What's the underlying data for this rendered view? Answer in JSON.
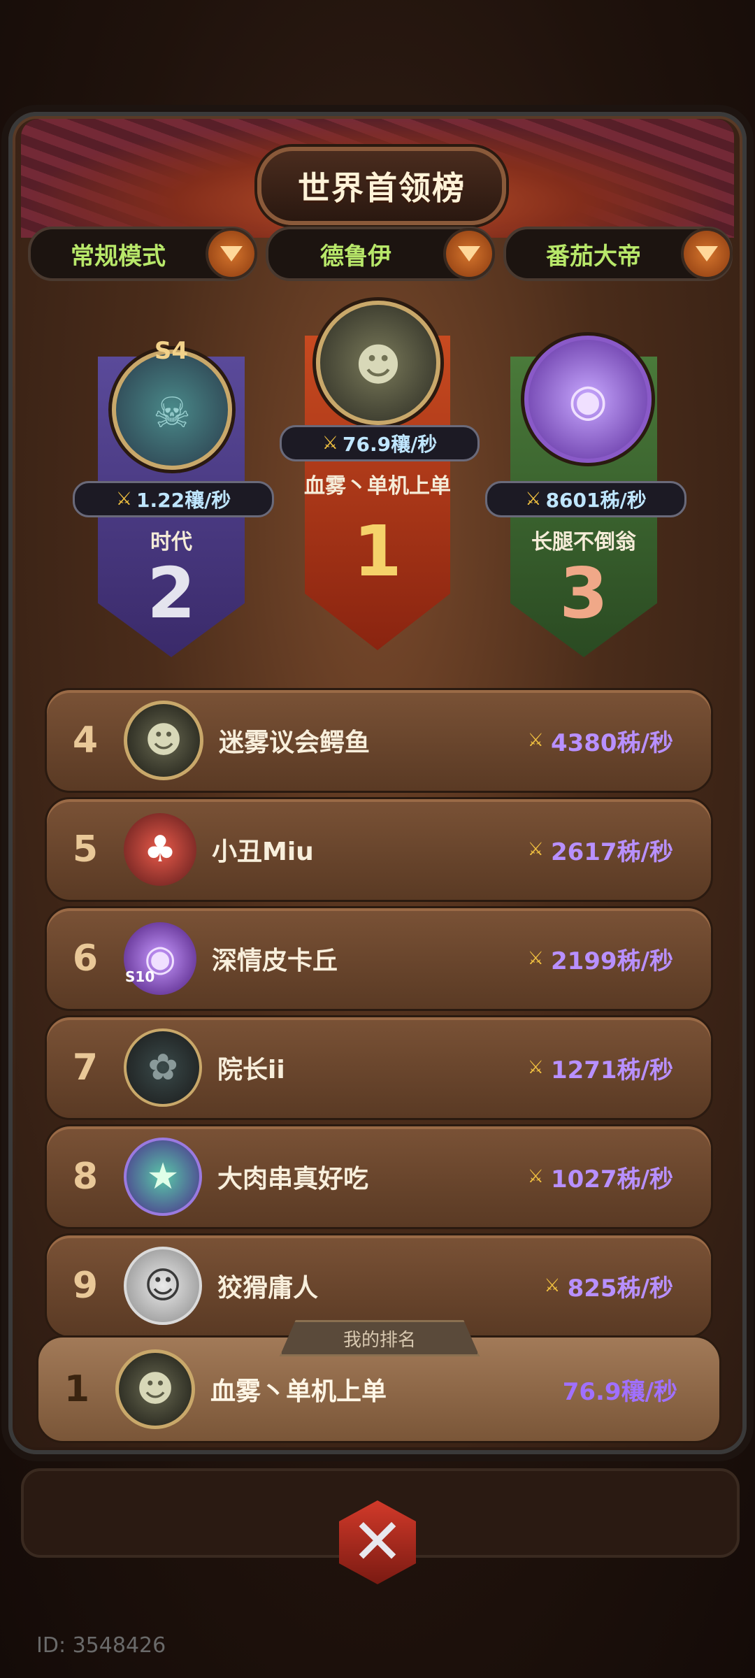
{
  "title": "世界首领榜",
  "filters": [
    {
      "label": "常规模式"
    },
    {
      "label": "德鲁伊"
    },
    {
      "label": "番茄大帝"
    }
  ],
  "podium": {
    "first": {
      "rank": "1",
      "name": "血雾丶单机上单",
      "score": "76.9穰/秒"
    },
    "second": {
      "rank": "2",
      "name": "时代",
      "score": "1.22穰/秒",
      "badge": "S4"
    },
    "third": {
      "rank": "3",
      "name": "长腿不倒翁",
      "score": "8601秭/秒"
    }
  },
  "list": [
    {
      "rank": "4",
      "name": "迷雾议会鳄鱼",
      "score": "4380秭/秒"
    },
    {
      "rank": "5",
      "name": "小丑Miu",
      "score": "2617秭/秒"
    },
    {
      "rank": "6",
      "name": "深情皮卡丘",
      "score": "2199秭/秒",
      "badge": "S10"
    },
    {
      "rank": "7",
      "name": "院长ii",
      "score": "1271秭/秒"
    },
    {
      "rank": "8",
      "name": "大肉串真好吃",
      "score": "1027秭/秒"
    },
    {
      "rank": "9",
      "name": "狡猾庸人",
      "score": "825秭/秒"
    }
  ],
  "my_rank": {
    "tag": "我的排名",
    "rank": "1",
    "name": "血雾丶单机上单",
    "score": "76.9穰/秒"
  },
  "player_id": "ID: 3548426",
  "colors": {
    "accent_green": "#b8e86a",
    "score_purple": "#b890ff",
    "gold": "#e9c898"
  }
}
